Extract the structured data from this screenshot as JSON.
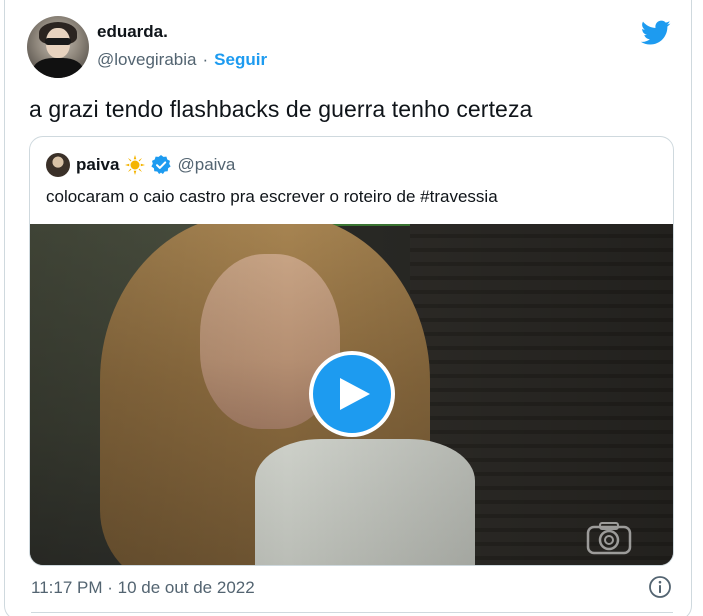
{
  "author": {
    "name": "eduarda.",
    "handle": "@lovegirabia",
    "separator": "·",
    "follow_label": "Seguir"
  },
  "tweet": {
    "text": "a grazi tendo flashbacks de guerra tenho certeza",
    "timestamp": "11:17 PM · 10 de out de 2022"
  },
  "quoted_tweet": {
    "name": "paiva",
    "handle": "@paiva",
    "text": "colocaram o caio castro pra escrever o roteiro de #travessia",
    "media": {
      "type": "video",
      "play_icon": "play-icon",
      "watermark_icon": "camera-watermark-icon"
    }
  },
  "icons": {
    "logo": "twitter-bird-icon",
    "verified": "verified-badge-icon",
    "emoji": "sun-emoji-icon",
    "info": "info-icon"
  },
  "colors": {
    "accent": "#1d9bf0",
    "text": "#0f1419",
    "secondary_text": "#536471",
    "border": "#cfd9de"
  }
}
